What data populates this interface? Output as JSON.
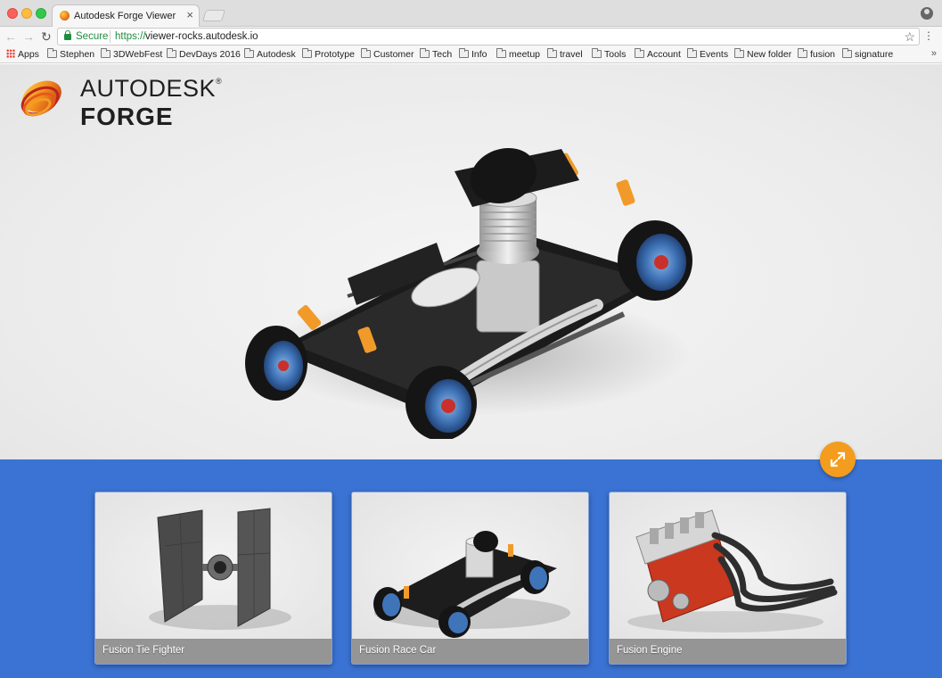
{
  "browser": {
    "tab_title": "Autodesk Forge Viewer",
    "tab_close": "×",
    "secure_label": "Secure",
    "url_scheme": "https://",
    "url_host": "viewer-rocks.autodesk.io",
    "bookmarks": [
      "Apps",
      "Stephen",
      "3DWebFest",
      "DevDays 2016",
      "Autodesk",
      "Prototype",
      "Customer",
      "Tech",
      "Info",
      "meetup",
      "travel",
      "Tools",
      "Account",
      "Events",
      "New folder",
      "fusion",
      "signature"
    ],
    "bookmarks_more": "»"
  },
  "logo": {
    "line1": "AUTODESK",
    "registered": "®",
    "line2": "FORGE"
  },
  "viewer": {
    "model_icon": "race-car-3d-model"
  },
  "fullscreen": {
    "icon": "expand-arrows-icon"
  },
  "gallery": {
    "items": [
      {
        "label": "Fusion Tie Fighter",
        "icon": "tie-fighter-thumbnail"
      },
      {
        "label": "Fusion Race Car",
        "icon": "race-car-thumbnail"
      },
      {
        "label": "Fusion Engine",
        "icon": "engine-thumbnail"
      }
    ]
  },
  "colors": {
    "gallery_bg": "#3b73d4",
    "accent_orange": "#f39c1e",
    "secure_green": "#1e8e3e"
  }
}
